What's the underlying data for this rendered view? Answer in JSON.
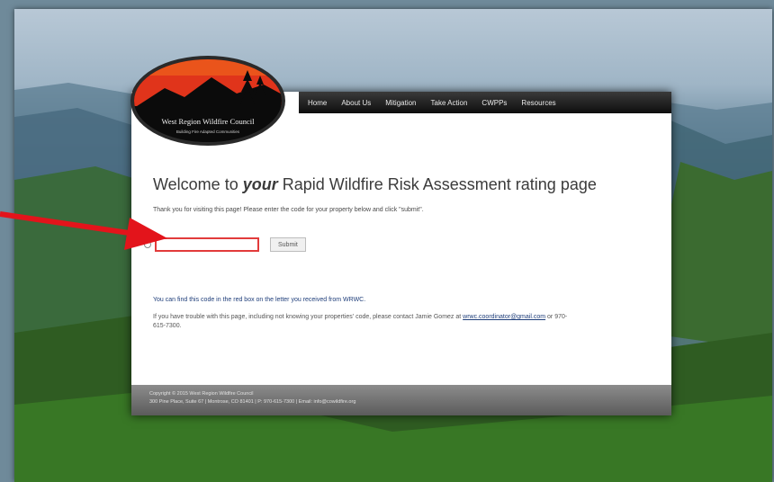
{
  "nav": {
    "items": [
      "Home",
      "About Us",
      "Mitigation",
      "Take Action",
      "CWPPs",
      "Resources"
    ]
  },
  "logo": {
    "name": "West Region Wildfire Council",
    "tagline": "Building Fire Adapted Communities"
  },
  "main": {
    "heading_prefix": "Welcome to ",
    "heading_emphasis": "your",
    "heading_suffix": " Rapid Wildfire Risk Assessment rating page",
    "intro": "Thank you for visiting this page! Please enter the code for your property below and click \"submit\".",
    "code_input_value": "",
    "submit_label": "Submit",
    "hint": "You can find this code in the red box on the letter you received from WRWC.",
    "help_text": "If you have trouble with this page, including not knowing your properties' code, please contact Jamie Gomez at",
    "help_email": "wrwc.coordinator@gmail.com",
    "help_phone_suffix": " or 970-615-7300."
  },
  "footer": {
    "line1": "Copyright © 2015 West Region Wildfire Council",
    "line2": "300 Pine Place, Suite 67 | Montrose, CO 81401 | P: 970-615-7300 | Email: info@cowildfire.org"
  },
  "colors": {
    "annotation_arrow": "#e3141b",
    "input_border": "#e23b3b",
    "logo_sky": "#e0341b"
  }
}
